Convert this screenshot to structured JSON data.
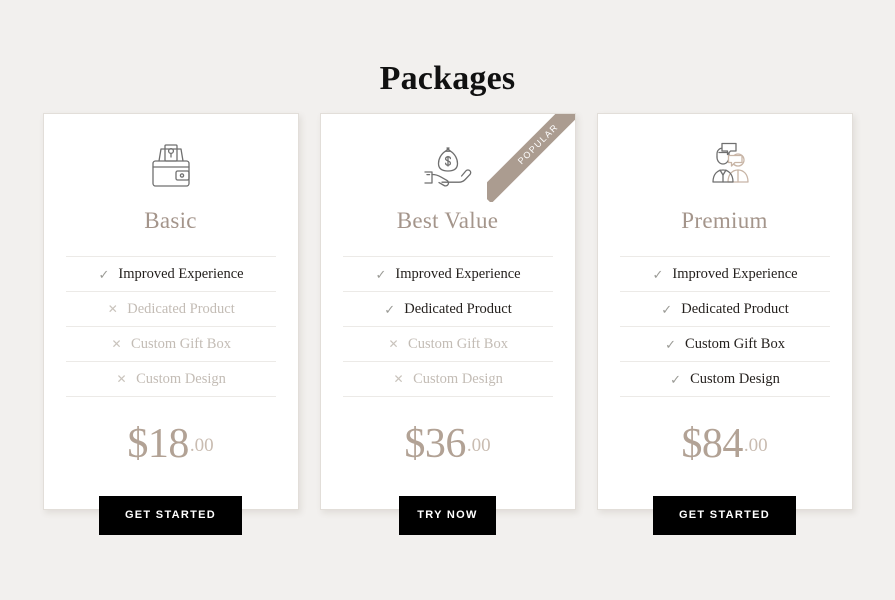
{
  "page": {
    "title": "Packages",
    "background_color": "#f2f0ee",
    "accent_color": "#a4958b",
    "ribbon_color": "#ab9c90",
    "button_color": "#000000"
  },
  "cards": [
    {
      "id": "basic",
      "name": "Basic",
      "icon": "wallet-cash-icon",
      "ribbon": null,
      "price": {
        "currency": "$",
        "amount": "18",
        "cents": ".00"
      },
      "features": [
        {
          "label": "Improved Experience",
          "included": true,
          "mark": "✓"
        },
        {
          "label": "Dedicated Product",
          "included": false,
          "mark": "✕"
        },
        {
          "label": "Custom Gift Box",
          "included": false,
          "mark": "✕"
        },
        {
          "label": "Custom Design",
          "included": false,
          "mark": "✕"
        }
      ],
      "cta_label": "GET STARTED"
    },
    {
      "id": "best-value",
      "name": "Best Value",
      "icon": "hand-money-bag-icon",
      "ribbon": "POPULAR",
      "price": {
        "currency": "$",
        "amount": "36",
        "cents": ".00"
      },
      "features": [
        {
          "label": "Improved Experience",
          "included": true,
          "mark": "✓"
        },
        {
          "label": "Dedicated Product",
          "included": true,
          "mark": "✓"
        },
        {
          "label": "Custom Gift Box",
          "included": false,
          "mark": "✕"
        },
        {
          "label": "Custom Design",
          "included": false,
          "mark": "✕"
        }
      ],
      "cta_label": "TRY NOW"
    },
    {
      "id": "premium",
      "name": "Premium",
      "icon": "people-chat-icon",
      "ribbon": null,
      "price": {
        "currency": "$",
        "amount": "84",
        "cents": ".00"
      },
      "features": [
        {
          "label": "Improved Experience",
          "included": true,
          "mark": "✓"
        },
        {
          "label": "Dedicated Product",
          "included": true,
          "mark": "✓"
        },
        {
          "label": "Custom Gift Box",
          "included": true,
          "mark": "✓"
        },
        {
          "label": "Custom Design",
          "included": true,
          "mark": "✓"
        }
      ],
      "cta_label": "GET STARTED"
    }
  ]
}
